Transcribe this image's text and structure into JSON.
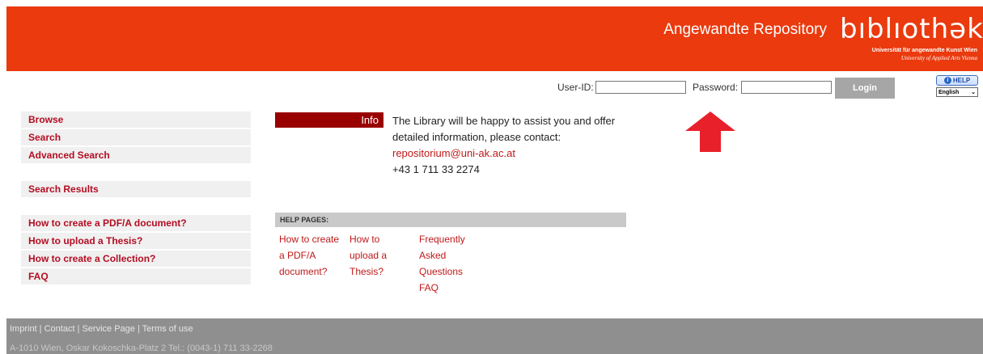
{
  "header": {
    "repo_title": "Angewandte Repository",
    "logo_word": "bıblıothək",
    "logo_line1": "Universität für angewandte Kunst Wien",
    "logo_line2": "University of Applied Arts Vienna",
    "bg_color": "#ea3a0e"
  },
  "login": {
    "user_label": "User-ID:",
    "user_value": "",
    "password_label": "Password:",
    "password_value": "",
    "button_label": "Login",
    "help_label": "HELP",
    "language": "English"
  },
  "sidebar": {
    "items": [
      "Browse",
      "Search",
      "Advanced Search"
    ],
    "results": "Search Results",
    "help_items": [
      "How to create a PDF/A document?",
      "How to upload a Thesis?",
      "How to create a Collection?",
      "FAQ"
    ]
  },
  "info": {
    "label": "Info",
    "line1": "The Library will be happy to assist you and offer",
    "line2": "detailed information, please contact:",
    "email": "repositorium@uni-ak.ac.at",
    "phone": "+43 1 711 33 2274"
  },
  "help_pages": {
    "header": "HELP PAGES:",
    "col1": [
      "How to create",
      "a PDF/A",
      "document?"
    ],
    "col2": [
      "How to",
      "upload a",
      "Thesis?"
    ],
    "col3": [
      "Frequently",
      "Asked",
      "Questions",
      "FAQ"
    ]
  },
  "footer": {
    "links": "Imprint | Contact | Service Page | Terms of use",
    "address": "A-1010 Wien, Oskar Kokoschka-Platz 2 Tel.: (0043-1) 711 33-2268"
  },
  "annotation": {
    "arrow_color": "#e8202a"
  }
}
